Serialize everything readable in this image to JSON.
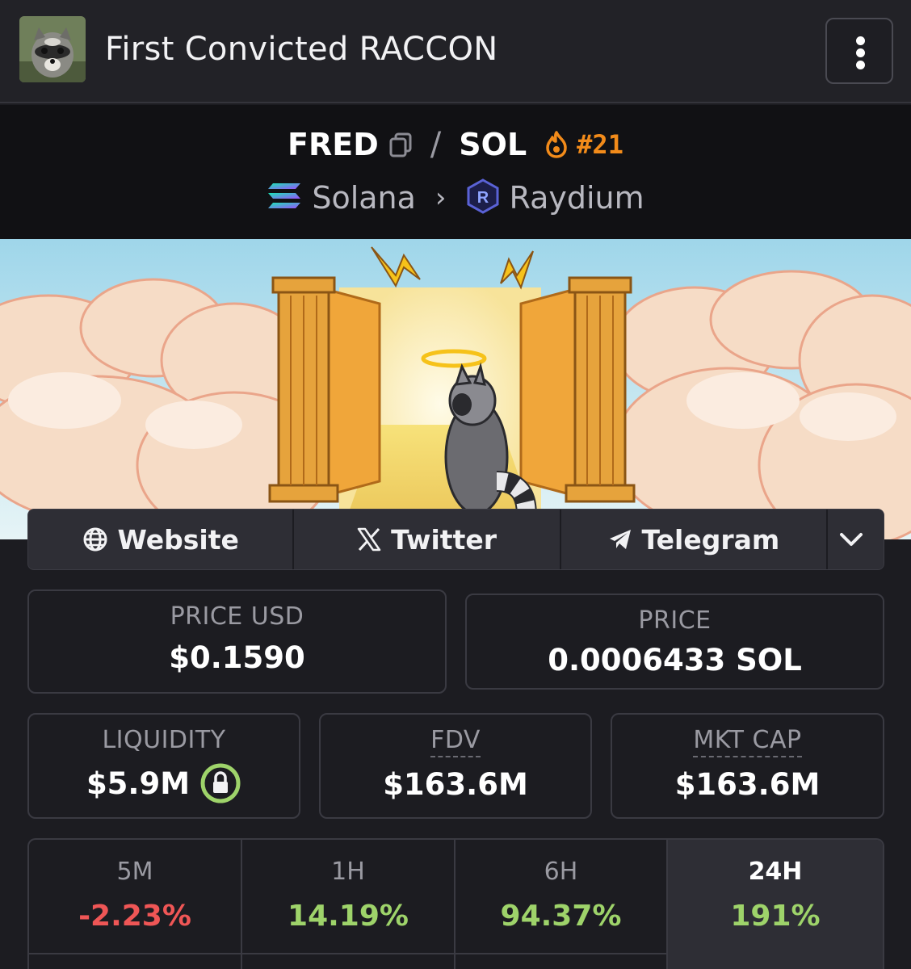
{
  "header": {
    "title": "First Convicted RACCON",
    "menu_icon": "more-vertical-icon"
  },
  "pair": {
    "base": "FRED",
    "separator": "/",
    "quote": "SOL",
    "rank": "#21",
    "chain": "Solana",
    "dex": "Raydium"
  },
  "links": {
    "website": "Website",
    "twitter": "Twitter",
    "telegram": "Telegram"
  },
  "stats": {
    "price_usd_label": "PRICE USD",
    "price_usd": "$0.1590",
    "price_label": "PRICE",
    "price": "0.0006433 SOL",
    "liquidity_label": "LIQUIDITY",
    "liquidity": "$5.9M",
    "fdv_label": "FDV",
    "fdv": "$163.6M",
    "mcap_label": "MKT CAP",
    "mcap": "$163.6M"
  },
  "timeframes": [
    {
      "label": "5M",
      "value": "-2.23%",
      "trend": "down"
    },
    {
      "label": "1H",
      "value": "14.19%",
      "trend": "up"
    },
    {
      "label": "6H",
      "value": "94.37%",
      "trend": "up"
    },
    {
      "label": "24H",
      "value": "191%",
      "trend": "up",
      "active": true
    }
  ],
  "colors": {
    "up": "#9ed36a",
    "down": "#ef5656",
    "rank": "#f28b1a",
    "background": "#1c1c21"
  }
}
